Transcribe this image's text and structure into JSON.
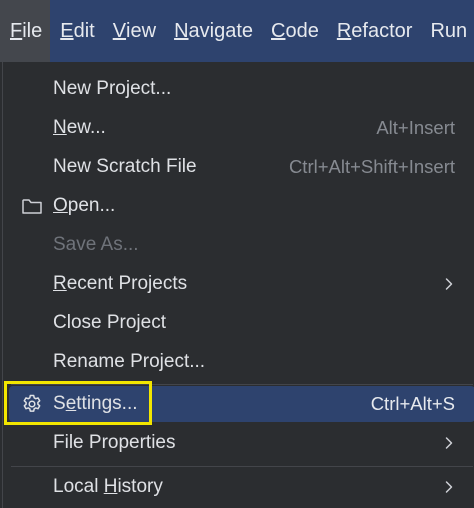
{
  "menubar": {
    "items": [
      {
        "label_mn": "F",
        "label_rest": "ile"
      },
      {
        "label_mn": "E",
        "label_rest": "dit"
      },
      {
        "label_mn": "V",
        "label_rest": "iew"
      },
      {
        "label_mn": "N",
        "label_rest": "avigate"
      },
      {
        "label_mn": "C",
        "label_rest": "ode"
      },
      {
        "label_mn": "R",
        "label_rest": "efactor"
      },
      {
        "label_mn": "",
        "label_rest": "Run"
      }
    ]
  },
  "file_menu": {
    "new_project": "New Project...",
    "new": {
      "mn": "N",
      "rest": "ew...",
      "shortcut": "Alt+Insert"
    },
    "new_scratch": {
      "label": "New Scratch File",
      "shortcut": "Ctrl+Alt+Shift+Insert"
    },
    "open": {
      "mn": "O",
      "rest": "pen...",
      "icon": "folder-icon"
    },
    "save_as": "Save As...",
    "recent_projects": {
      "mn": "R",
      "rest": "ecent Projects"
    },
    "close_project": "Close Project",
    "rename_project": "Rename Project...",
    "settings": {
      "pre": "S",
      "mn": "e",
      "rest": "ttings...",
      "shortcut": "Ctrl+Alt+S",
      "icon": "gear-icon"
    },
    "file_properties": "File Properties",
    "local_history": {
      "pre": "Local ",
      "mn": "H",
      "rest": "istory"
    }
  },
  "colors": {
    "menubar_bg": "#2e436e",
    "selected_bg": "#2e436e",
    "highlight_box": "#f2e600",
    "menu_bg": "#2b2d30"
  }
}
